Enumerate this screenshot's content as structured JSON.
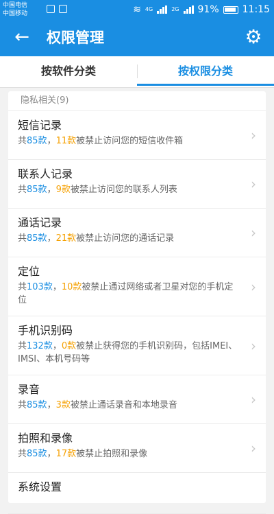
{
  "status_bar": {
    "carrier_1": "中国电信",
    "carrier_2": "中国移动",
    "network_4g": "4G",
    "network_2g": "2G",
    "battery": "91%",
    "time": "11:15"
  },
  "app_bar": {
    "title": "权限管理"
  },
  "tabs": [
    {
      "label": "按软件分类",
      "active": false
    },
    {
      "label": "按权限分类",
      "active": true
    }
  ],
  "section": {
    "header": "隐私相关(9)"
  },
  "items": [
    {
      "title": "短信记录",
      "prefix": "共",
      "total": "85款",
      "sep": "，",
      "blocked": "11款",
      "suffix": "被禁止访问您的短信收件箱"
    },
    {
      "title": "联系人记录",
      "prefix": "共",
      "total": "85款",
      "sep": "，",
      "blocked": "9款",
      "suffix": "被禁止访问您的联系人列表"
    },
    {
      "title": "通话记录",
      "prefix": "共",
      "total": "85款",
      "sep": "，",
      "blocked": "21款",
      "suffix": "被禁止访问您的通话记录"
    },
    {
      "title": "定位",
      "prefix": "共",
      "total": "103款",
      "sep": "，",
      "blocked": "10款",
      "suffix": "被禁止通过网络或者卫星对您的手机定位"
    },
    {
      "title": "手机识别码",
      "prefix": "共",
      "total": "132款",
      "sep": "，",
      "blocked": "0款",
      "suffix": "被禁止获得您的手机识别码，包括IMEI、IMSI、本机号码等"
    },
    {
      "title": "录音",
      "prefix": "共",
      "total": "85款",
      "sep": "，",
      "blocked": "3款",
      "suffix": "被禁止通话录音和本地录音"
    },
    {
      "title": "拍照和录像",
      "prefix": "共",
      "total": "85款",
      "sep": "，",
      "blocked": "17款",
      "suffix": "被禁止拍照和录像"
    },
    {
      "title": "系统设置",
      "prefix": "",
      "total": "",
      "sep": "",
      "blocked": "",
      "suffix": ""
    }
  ],
  "colors": {
    "primary": "#1a8ee2",
    "accent_orange": "#f5a000"
  },
  "icons": {
    "back": "arrow-left",
    "settings": "gear",
    "chevron": "chevron-right"
  }
}
